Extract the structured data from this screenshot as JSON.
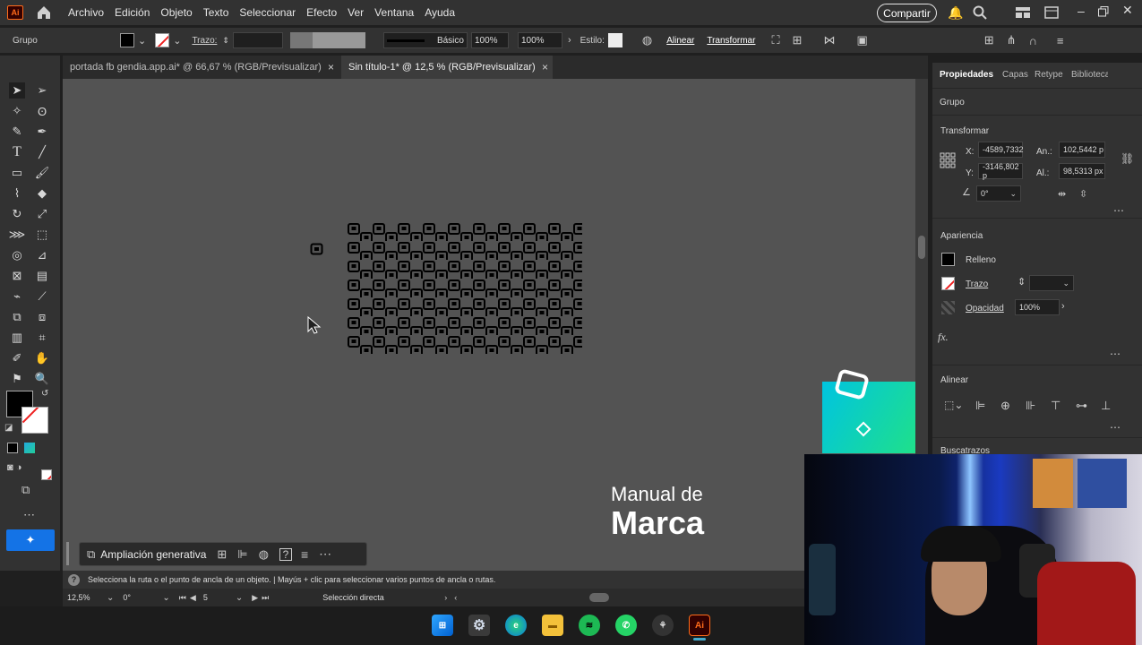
{
  "app": {
    "logo_text": "Ai",
    "share_label": "Compartir"
  },
  "menu": [
    "Archivo",
    "Edición",
    "Objeto",
    "Texto",
    "Seleccionar",
    "Efecto",
    "Ver",
    "Ventana",
    "Ayuda"
  ],
  "control_bar": {
    "selection_type": "Grupo",
    "stroke_label": "Trazo:",
    "brush_label": "Básico",
    "opacity_1": "100%",
    "opacity_2": "100%",
    "style_label": "Estilo:",
    "align_link": "Alinear",
    "transform_link": "Transformar"
  },
  "tabs": [
    {
      "label": "portada fb gendia.app.ai* @ 66,67 % (RGB/Previsualizar)",
      "active": false
    },
    {
      "label": "Sin título-1* @ 12,5 % (RGB/Previsualizar)",
      "active": true
    }
  ],
  "canvas": {
    "title_line1": "Manual de",
    "title_line2": "Marca",
    "teal_gradient": [
      "#00c4e0",
      "#1fe08a"
    ],
    "pattern_color": "#000000"
  },
  "properties_panel": {
    "tabs": [
      "Propiedades",
      "Capas",
      "Retype",
      "Bibliotecas"
    ],
    "section_type": "Grupo",
    "transform_title": "Transformar",
    "x_label": "X:",
    "x_value": "-4589,7332",
    "y_label": "Y:",
    "y_value": "-3146,802 p",
    "w_label": "An.:",
    "w_value": "102,5442 p",
    "h_label": "Al.:",
    "h_value": "98,5313 px",
    "rotation_value": "0°",
    "appearance_title": "Apariencia",
    "fill_label": "Relleno",
    "stroke_label": "Trazo",
    "opacity_label": "Opacidad",
    "opacity_value": "100%",
    "fx_label": "fx.",
    "align_title": "Alinear",
    "pathfinder_title": "Buscatrazos"
  },
  "context_bar": {
    "gen_expand_label": "Ampliación generativa"
  },
  "status": {
    "hint": "Selecciona la ruta o el punto de ancla de un objeto.  |  Mayús + clic para seleccionar varios puntos de ancla o rutas.",
    "zoom": "12,5%",
    "rotation": "0°",
    "artboard": "5",
    "tool_name": "Selección directa"
  },
  "colors": {
    "accent_blue": "#1473e6",
    "ui_dark": "#323232",
    "canvas_bg": "#535353"
  }
}
